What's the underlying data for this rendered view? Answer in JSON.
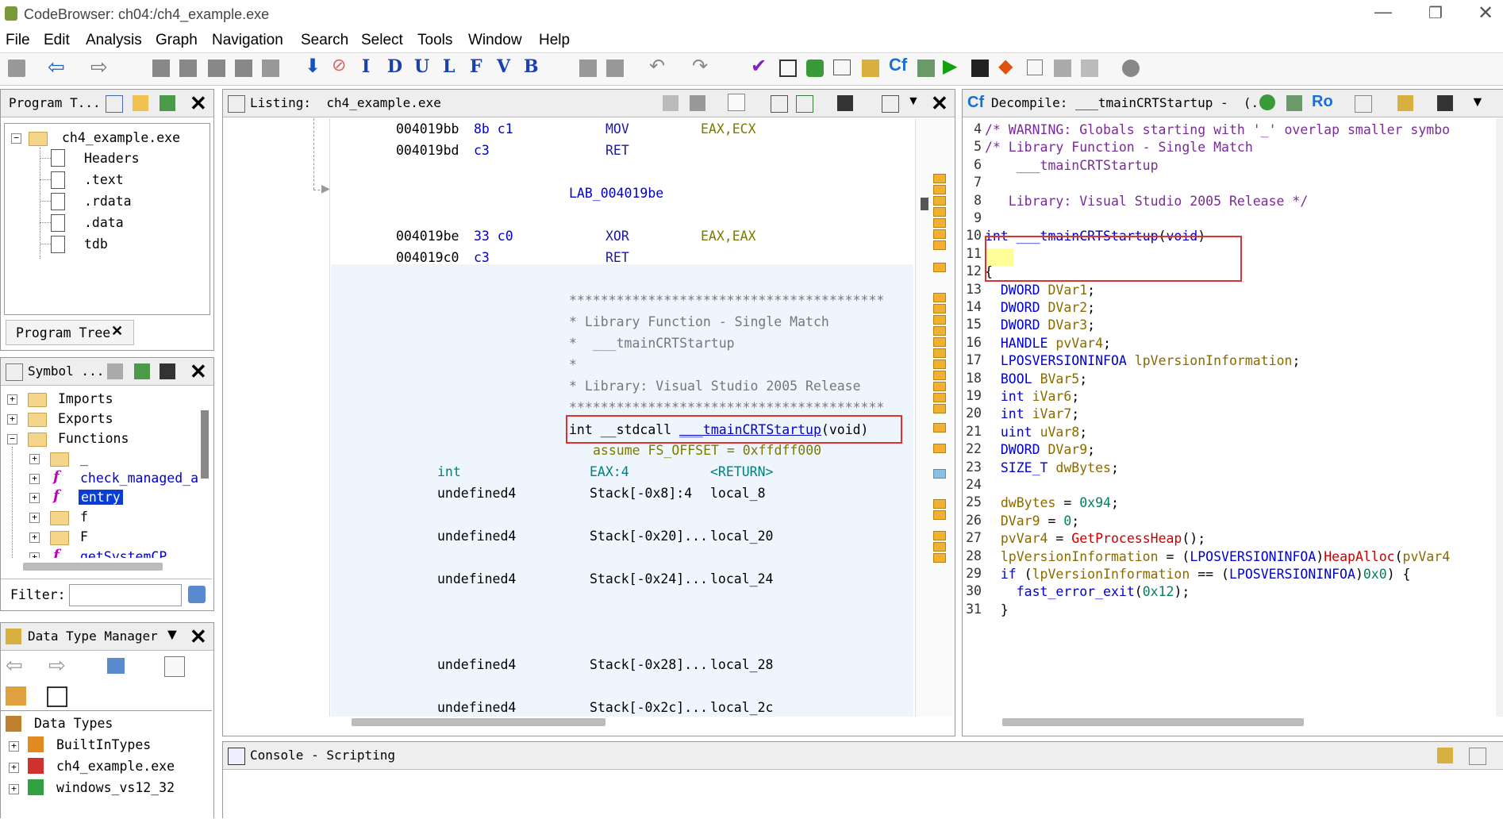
{
  "window": {
    "title": "CodeBrowser: ch04:/ch4_example.exe"
  },
  "menu": [
    "File",
    "Edit",
    "Analysis",
    "Graph",
    "Navigation",
    "Search",
    "Select",
    "Tools",
    "Window",
    "Help"
  ],
  "program_tree": {
    "title": "Program T...",
    "root": "ch4_example.exe",
    "items": [
      "Headers",
      ".text",
      ".rdata",
      ".data",
      "tdb"
    ],
    "tab": "Program Tree"
  },
  "symbol_tree": {
    "title": "Symbol ...",
    "items": [
      {
        "label": "Imports",
        "kind": "folder"
      },
      {
        "label": "Exports",
        "kind": "folder"
      },
      {
        "label": "Functions",
        "kind": "folder-open"
      }
    ],
    "functions": [
      {
        "label": "_",
        "kind": "folder"
      },
      {
        "label": "check_managed_ap",
        "kind": "func"
      },
      {
        "label": "entry",
        "kind": "func-selected"
      },
      {
        "label": "f",
        "kind": "folder"
      },
      {
        "label": "F",
        "kind": "folder"
      },
      {
        "label": "getSystemCP",
        "kind": "func"
      }
    ],
    "filter_label": "Filter:",
    "filter_value": ""
  },
  "dtm": {
    "title": "Data Type Manager",
    "root": "Data Types",
    "items": [
      "BuiltInTypes",
      "ch4_example.exe",
      "windows_vs12_32"
    ]
  },
  "listing": {
    "title": "Listing:  ch4_example.exe",
    "lines": [
      {
        "addr": "004019bb",
        "bytes": "8b c1",
        "mnem": "MOV",
        "ops": "EAX,ECX"
      },
      {
        "addr": "004019bd",
        "bytes": "c3",
        "mnem": "RET",
        "ops": ""
      },
      {
        "label": "LAB_004019be"
      },
      {
        "addr": "004019be",
        "bytes": "33 c0",
        "mnem": "XOR",
        "ops": "EAX,EAX"
      },
      {
        "addr": "004019c0",
        "bytes": "c3",
        "mnem": "RET",
        "ops": ""
      }
    ],
    "stars1": "****************************************",
    "c1": "* Library Function - Single Match",
    "c2": "*  ___tmainCRTStartup",
    "c3": "*",
    "c4": "* Library: Visual Studio 2005 Release",
    "stars2": "****************************************",
    "sig_pre": "int __stdcall ",
    "sig_name": "___tmainCRTStartup",
    "sig_post": "(void)",
    "assume": "assume FS_OFFSET = 0xffdff000",
    "ret": {
      "type": "int",
      "loc": "EAX:4",
      "name": "<RETURN>"
    },
    "vars": [
      {
        "type": "undefined4",
        "loc": "Stack[-0x8]:4",
        "name": "local_8"
      },
      {
        "type": "undefined4",
        "loc": "Stack[-0x20]...",
        "name": "local_20"
      },
      {
        "type": "undefined4",
        "loc": "Stack[-0x24]...",
        "name": "local_24"
      },
      {
        "type": "undefined4",
        "loc": "Stack[-0x28]...",
        "name": "local_28"
      },
      {
        "type": "undefined4",
        "loc": "Stack[-0x2c]...",
        "name": "local_2c"
      }
    ]
  },
  "decompile": {
    "title": "Decompile: ___tmainCRTStartup -  (...",
    "lines": [
      {
        "n": "4",
        "parts": [
          [
            "c",
            "/* WARNING: Globals starting with '_' overlap smaller symbo"
          ]
        ]
      },
      {
        "n": "5",
        "parts": [
          [
            "c",
            "/* Library Function - Single Match"
          ]
        ]
      },
      {
        "n": "6",
        "parts": [
          [
            "c",
            "    ___tmainCRTStartup"
          ]
        ]
      },
      {
        "n": "7",
        "parts": []
      },
      {
        "n": "8",
        "parts": [
          [
            "c",
            "   Library: Visual Studio 2005 Release */"
          ]
        ]
      },
      {
        "n": "9",
        "parts": []
      },
      {
        "n": "10",
        "parts": [
          [
            "kw",
            "int"
          ],
          [
            "p",
            " "
          ],
          [
            "fn",
            "___tmainCRTStartup"
          ],
          [
            "p",
            "("
          ],
          [
            "kw",
            "void"
          ],
          [
            "p",
            ")"
          ]
        ]
      },
      {
        "n": "11",
        "parts": []
      },
      {
        "n": "12",
        "parts": [
          [
            "p",
            "{"
          ]
        ]
      },
      {
        "n": "13",
        "parts": [
          [
            "p",
            "  "
          ],
          [
            "kw",
            "DWORD"
          ],
          [
            "p",
            " "
          ],
          [
            "v",
            "DVar1"
          ],
          [
            "p",
            ";"
          ]
        ]
      },
      {
        "n": "14",
        "parts": [
          [
            "p",
            "  "
          ],
          [
            "kw",
            "DWORD"
          ],
          [
            "p",
            " "
          ],
          [
            "v",
            "DVar2"
          ],
          [
            "p",
            ";"
          ]
        ]
      },
      {
        "n": "15",
        "parts": [
          [
            "p",
            "  "
          ],
          [
            "kw",
            "DWORD"
          ],
          [
            "p",
            " "
          ],
          [
            "v",
            "DVar3"
          ],
          [
            "p",
            ";"
          ]
        ]
      },
      {
        "n": "16",
        "parts": [
          [
            "p",
            "  "
          ],
          [
            "kw",
            "HANDLE"
          ],
          [
            "p",
            " "
          ],
          [
            "v",
            "pvVar4"
          ],
          [
            "p",
            ";"
          ]
        ]
      },
      {
        "n": "17",
        "parts": [
          [
            "p",
            "  "
          ],
          [
            "kw",
            "LPOSVERSIONINFOA"
          ],
          [
            "p",
            " "
          ],
          [
            "v",
            "lpVersionInformation"
          ],
          [
            "p",
            ";"
          ]
        ]
      },
      {
        "n": "18",
        "parts": [
          [
            "p",
            "  "
          ],
          [
            "kw",
            "BOOL"
          ],
          [
            "p",
            " "
          ],
          [
            "v",
            "BVar5"
          ],
          [
            "p",
            ";"
          ]
        ]
      },
      {
        "n": "19",
        "parts": [
          [
            "p",
            "  "
          ],
          [
            "kw",
            "int"
          ],
          [
            "p",
            " "
          ],
          [
            "v",
            "iVar6"
          ],
          [
            "p",
            ";"
          ]
        ]
      },
      {
        "n": "20",
        "parts": [
          [
            "p",
            "  "
          ],
          [
            "kw",
            "int"
          ],
          [
            "p",
            " "
          ],
          [
            "v",
            "iVar7"
          ],
          [
            "p",
            ";"
          ]
        ]
      },
      {
        "n": "21",
        "parts": [
          [
            "p",
            "  "
          ],
          [
            "kw",
            "uint"
          ],
          [
            "p",
            " "
          ],
          [
            "v",
            "uVar8"
          ],
          [
            "p",
            ";"
          ]
        ]
      },
      {
        "n": "22",
        "parts": [
          [
            "p",
            "  "
          ],
          [
            "kw",
            "DWORD"
          ],
          [
            "p",
            " "
          ],
          [
            "v",
            "DVar9"
          ],
          [
            "p",
            ";"
          ]
        ]
      },
      {
        "n": "23",
        "parts": [
          [
            "p",
            "  "
          ],
          [
            "kw",
            "SIZE_T"
          ],
          [
            "p",
            " "
          ],
          [
            "v",
            "dwBytes"
          ],
          [
            "p",
            ";"
          ]
        ]
      },
      {
        "n": "24",
        "parts": []
      },
      {
        "n": "25",
        "parts": [
          [
            "p",
            "  "
          ],
          [
            "v",
            "dwBytes"
          ],
          [
            "p",
            " = "
          ],
          [
            "num",
            "0x94"
          ],
          [
            "p",
            ";"
          ]
        ]
      },
      {
        "n": "26",
        "parts": [
          [
            "p",
            "  "
          ],
          [
            "v",
            "DVar9"
          ],
          [
            "p",
            " = "
          ],
          [
            "num",
            "0"
          ],
          [
            "p",
            ";"
          ]
        ]
      },
      {
        "n": "27",
        "parts": [
          [
            "p",
            "  "
          ],
          [
            "v",
            "pvVar4"
          ],
          [
            "p",
            " = "
          ],
          [
            "call",
            "GetProcessHeap"
          ],
          [
            "p",
            "();"
          ]
        ]
      },
      {
        "n": "28",
        "parts": [
          [
            "p",
            "  "
          ],
          [
            "v",
            "lpVersionInformation"
          ],
          [
            "p",
            " = ("
          ],
          [
            "kw",
            "LPOSVERSIONINFOA"
          ],
          [
            "p",
            ")"
          ],
          [
            "call",
            "HeapAlloc"
          ],
          [
            "p",
            "("
          ],
          [
            "v",
            "pvVar4"
          ]
        ]
      },
      {
        "n": "29",
        "parts": [
          [
            "p",
            "  "
          ],
          [
            "kw",
            "if"
          ],
          [
            "p",
            " ("
          ],
          [
            "v",
            "lpVersionInformation"
          ],
          [
            "p",
            " == ("
          ],
          [
            "kw",
            "LPOSVERSIONINFOA"
          ],
          [
            "p",
            ")"
          ],
          [
            "num",
            "0x0"
          ],
          [
            "p",
            ") {"
          ]
        ]
      },
      {
        "n": "30",
        "parts": [
          [
            "p",
            "    "
          ],
          [
            "fn",
            "fast_error_exit"
          ],
          [
            "p",
            "("
          ],
          [
            "num",
            "0x12"
          ],
          [
            "p",
            ");"
          ]
        ]
      },
      {
        "n": "31",
        "parts": [
          [
            "p",
            "  }"
          ]
        ]
      }
    ]
  },
  "console": {
    "title": "Console - Scripting"
  },
  "colors": {
    "accent": "#0000cc",
    "highlight_box": "#e03030",
    "selection": "#0a3dd8"
  }
}
